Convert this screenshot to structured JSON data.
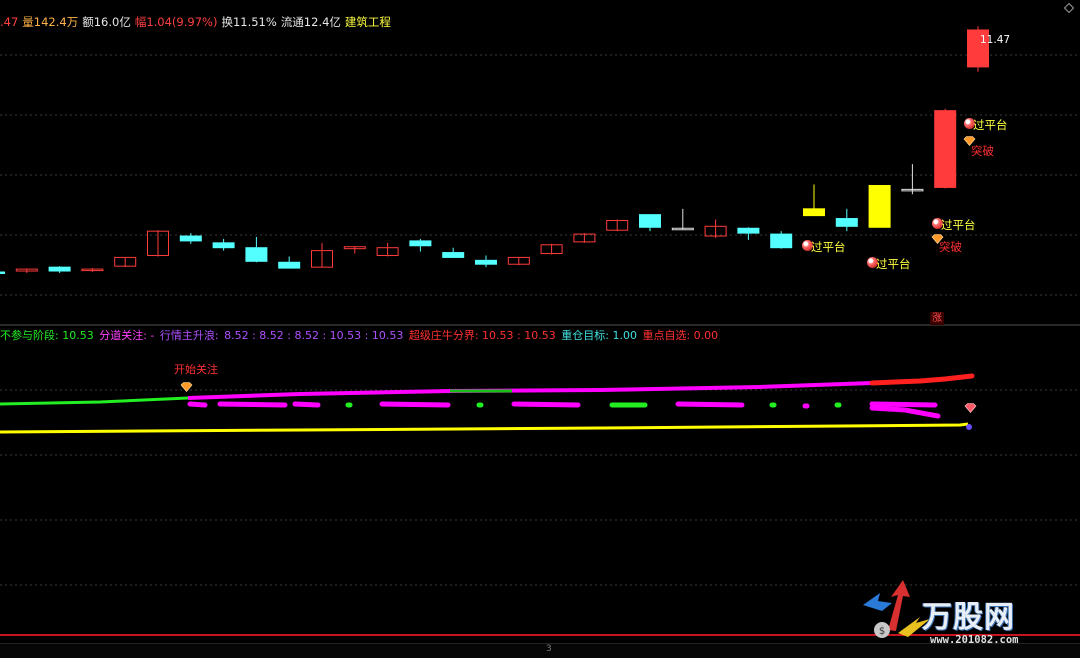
{
  "info_bar": {
    "price_fragment": ".47",
    "volume": "量142.4万",
    "amount": "额16.0亿",
    "change": "幅1.04(9.97%)",
    "turnover": "换11.51%",
    "float_value": "流通12.4亿",
    "sector": "建筑工程"
  },
  "price_label": "11.47",
  "candles": [
    {
      "o": 6.76,
      "h": 6.78,
      "l": 6.74,
      "c": 6.77,
      "style": "cyan"
    },
    {
      "o": 6.78,
      "h": 6.8,
      "l": 6.76,
      "c": 6.8,
      "style": "red"
    },
    {
      "o": 6.82,
      "h": 6.83,
      "l": 6.76,
      "c": 6.78,
      "style": "cyan"
    },
    {
      "o": 6.79,
      "h": 6.81,
      "l": 6.77,
      "c": 6.8,
      "style": "red"
    },
    {
      "o": 6.83,
      "h": 6.92,
      "l": 6.82,
      "c": 6.92,
      "style": "red"
    },
    {
      "o": 6.94,
      "h": 7.2,
      "l": 6.93,
      "c": 7.19,
      "style": "red"
    },
    {
      "o": 7.14,
      "h": 7.17,
      "l": 7.06,
      "c": 7.09,
      "style": "cyan"
    },
    {
      "o": 7.07,
      "h": 7.11,
      "l": 6.99,
      "c": 7.02,
      "style": "cyan"
    },
    {
      "o": 7.02,
      "h": 7.13,
      "l": 6.87,
      "c": 6.88,
      "style": "cyan"
    },
    {
      "o": 6.87,
      "h": 6.93,
      "l": 6.81,
      "c": 6.81,
      "style": "cyan"
    },
    {
      "o": 6.82,
      "h": 7.07,
      "l": 6.82,
      "c": 6.99,
      "style": "red"
    },
    {
      "o": 7.01,
      "h": 7.03,
      "l": 6.96,
      "c": 7.03,
      "style": "red"
    },
    {
      "o": 6.94,
      "h": 7.07,
      "l": 6.93,
      "c": 7.02,
      "style": "red"
    },
    {
      "o": 7.09,
      "h": 7.11,
      "l": 6.98,
      "c": 7.04,
      "style": "cyan"
    },
    {
      "o": 6.97,
      "h": 7.02,
      "l": 6.93,
      "c": 6.92,
      "style": "cyan"
    },
    {
      "o": 6.89,
      "h": 6.94,
      "l": 6.82,
      "c": 6.85,
      "style": "cyan"
    },
    {
      "o": 6.85,
      "h": 6.92,
      "l": 6.84,
      "c": 6.92,
      "style": "red"
    },
    {
      "o": 6.96,
      "h": 7.06,
      "l": 6.95,
      "c": 7.05,
      "style": "red"
    },
    {
      "o": 7.08,
      "h": 7.17,
      "l": 7.07,
      "c": 7.16,
      "style": "red"
    },
    {
      "o": 7.2,
      "h": 7.31,
      "l": 7.19,
      "c": 7.3,
      "style": "red"
    },
    {
      "o": 7.36,
      "h": 7.36,
      "l": 7.19,
      "c": 7.23,
      "style": "cyan"
    },
    {
      "o": 7.22,
      "h": 7.42,
      "l": 7.21,
      "c": 7.22,
      "style": "doji"
    },
    {
      "o": 7.14,
      "h": 7.31,
      "l": 7.12,
      "c": 7.24,
      "style": "red"
    },
    {
      "o": 7.22,
      "h": 7.23,
      "l": 7.1,
      "c": 7.17,
      "style": "cyan"
    },
    {
      "o": 7.16,
      "h": 7.19,
      "l": 7.01,
      "c": 7.02,
      "style": "cyan"
    },
    {
      "o": 7.42,
      "h": 7.67,
      "l": 7.35,
      "c": 7.35,
      "style": "yellow"
    },
    {
      "o": 7.32,
      "h": 7.42,
      "l": 7.19,
      "c": 7.24,
      "style": "cyan"
    },
    {
      "o": 7.66,
      "h": 7.66,
      "l": 7.23,
      "c": 7.23,
      "style": "yellow"
    },
    {
      "o": 7.62,
      "h": 7.88,
      "l": 7.57,
      "c": 7.61,
      "style": "doji"
    },
    {
      "o": 7.64,
      "h": 8.45,
      "l": 7.63,
      "c": 8.43,
      "style": "solidred"
    },
    {
      "o": 8.88,
      "h": 9.3,
      "l": 8.83,
      "c": 9.26,
      "style": "solidred"
    }
  ],
  "markers": {
    "guo_ping_tai": "过平台",
    "tu_po": "突破",
    "kai_shi_guan_zhu": "开始关注",
    "zhang": "涨"
  },
  "indicator_bar": {
    "item1": "不参与阶段: 10.53",
    "item2": "分道关注: -",
    "item3_name": "行情主升浪:",
    "item3_values": "8.52 : 8.52 : 8.52 : 10.53 : 10.53",
    "item4": "超级庄牛分界: 10.53 : 10.53",
    "item5": "重仓目标: 1.00",
    "item6": "重点自选: 0.00"
  },
  "colors": {
    "up": "#ff3b3b",
    "down": "#54ffff",
    "yellow": "#ffff00",
    "magenta": "#ff00ff",
    "green": "#22ee22",
    "grid": "#3a3a3a"
  },
  "logo": {
    "text": "万股网",
    "url": "www.201082.com"
  },
  "scroll_mark": "3"
}
